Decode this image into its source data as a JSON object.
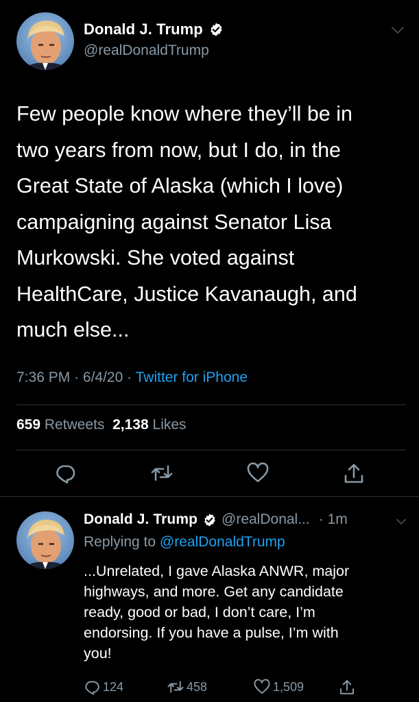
{
  "main_tweet": {
    "author_name": "Donald J. Trump",
    "handle": "@realDonaldTrump",
    "text": "Few people know where they’ll be in\ntwo years from now, but I do, in the\nGreat State of Alaska (which I love)\ncampaigning against Senator Lisa\nMurkowski. She voted against\nHealthCare, Justice Kavanaugh, and\nmuch else...",
    "time": "7:36 PM",
    "separator": "·",
    "date": "6/4/20",
    "source": "Twitter for iPhone",
    "retweets_count": "659",
    "retweets_label": "Retweets",
    "likes_count": "2,138",
    "likes_label": "Likes"
  },
  "reply_tweet": {
    "author_name": "Donald J. Trump",
    "handle": "@realDonal...",
    "time": "· 1m",
    "replying_prefix": "Replying to",
    "replying_to": "@realDonaldTrump",
    "text": "...Unrelated, I gave Alaska ANWR, major\nhighways, and more. Get any candidate\nready, good or bad, I don’t care, I’m\nendorsing. If you have a pulse, I’m with\nyou!",
    "replies": "124",
    "retweets": "458",
    "likes": "1,509"
  },
  "icons": {
    "verified": "verified-badge-icon",
    "chevron": "chevron-down-icon",
    "reply": "reply-icon",
    "retweet": "retweet-icon",
    "like": "heart-icon",
    "share": "share-icon"
  },
  "colors": {
    "background": "#000000",
    "text": "#ffffff",
    "secondary": "#8899a6",
    "link": "#1da1f2",
    "divider": "#2f3336"
  }
}
